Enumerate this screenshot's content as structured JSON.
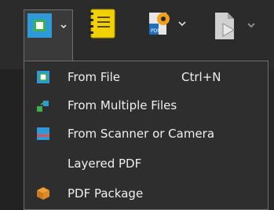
{
  "toolbar": {
    "buttons": [
      {
        "icon": "create-pdf-icon"
      },
      {
        "icon": "notebook-icon"
      },
      {
        "icon": "document-settings-icon"
      },
      {
        "icon": "page-icon"
      }
    ]
  },
  "menu": {
    "items": [
      {
        "label": "From File",
        "shortcut": "Ctrl+N",
        "icon": "from-file-icon"
      },
      {
        "label": "From Multiple Files",
        "shortcut": "",
        "icon": "multiple-files-icon"
      },
      {
        "label": "From Scanner or Camera",
        "shortcut": "",
        "icon": "scanner-icon"
      },
      {
        "label": "Layered PDF",
        "shortcut": "",
        "icon": ""
      },
      {
        "label": "PDF Package",
        "shortcut": "",
        "icon": "package-icon"
      }
    ]
  },
  "colors": {
    "accent_blue": "#2f9ad8",
    "accent_green": "#3fb04a",
    "menu_bg": "#2e2e2e",
    "text": "#f0f0f0"
  }
}
